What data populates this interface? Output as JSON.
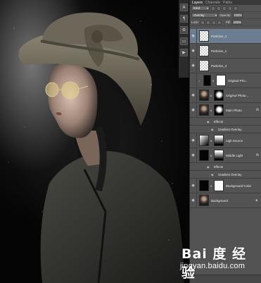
{
  "panel": {
    "tabs": [
      "Layers",
      "Channels",
      "Paths"
    ],
    "filter_label": "Kind",
    "blend_mode": "Overlay",
    "opacity_label": "Opacity:",
    "opacity_value": "100%",
    "lock_label": "Lock:",
    "fill_label": "Fill:",
    "fill_value": "100%",
    "layers": [
      {
        "name": "Particles_1"
      },
      {
        "name": "Particles_2"
      },
      {
        "name": "Particles_3"
      },
      {
        "name": "Original Pho..."
      },
      {
        "name": "Original Photo..."
      },
      {
        "name": "Main Photo",
        "fx": "fx"
      },
      {
        "effects_label": "Effects"
      },
      {
        "effect_name": "Gradient Overlay"
      },
      {
        "name": "Ligh Source"
      },
      {
        "name": "Middle Light",
        "fx": "fx"
      },
      {
        "effects_label": "Effects"
      },
      {
        "effect_name": "Gradient Overlay"
      },
      {
        "name": "Background Color"
      },
      {
        "name": "Background"
      }
    ]
  },
  "tools": [
    "A",
    "¶",
    "⚙",
    "▭",
    "▶"
  ],
  "watermark": {
    "logo_text": "Bai 度 经验",
    "url": "jingyan.baidu.com"
  },
  "icons": {
    "eye": "eye-icon",
    "fx": "fx-icon",
    "lock": "lock-icon",
    "link": "link-icon"
  }
}
